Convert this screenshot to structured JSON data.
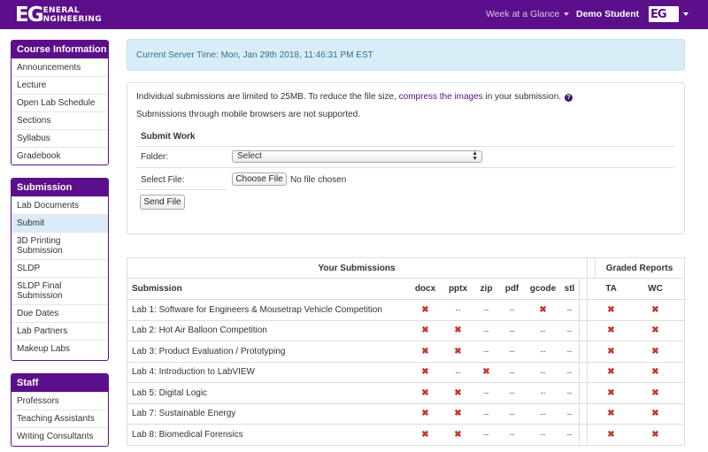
{
  "nav": {
    "logo_mark": "EG",
    "logo_line1": "ENERAL",
    "logo_line2": "NGINEERING",
    "week_label": "Week at a Glance",
    "user_label": "Demo Student",
    "user_logo_mark": "EG"
  },
  "sidebar": {
    "course": {
      "title": "Course Information",
      "items": [
        "Announcements",
        "Lecture",
        "Open Lab Schedule",
        "Sections",
        "Syllabus",
        "Gradebook"
      ]
    },
    "submission": {
      "title": "Submission",
      "items": [
        "Lab Documents",
        "Submit",
        "3D Printing Submission",
        "SLDP",
        "SLDP Final Submission",
        "Due Dates",
        "Lab Partners",
        "Makeup Labs"
      ],
      "active": "Submit"
    },
    "staff": {
      "title": "Staff",
      "items": [
        "Professors",
        "Teaching Assistants",
        "Writing Consultants"
      ]
    }
  },
  "alert": {
    "text": "Current Server Time: Mon, Jan 29th 2018, 11:46:31 PM EST"
  },
  "submit": {
    "note_before": "Individual submissions are limited to 25MB. To reduce the file size, ",
    "note_link": "compress the images",
    "note_after": " in your submission.",
    "help_glyph": "?",
    "mobile_note": "Submissions through mobile browsers are not supported.",
    "form_title": "Submit Work",
    "folder_label": "Folder:",
    "folder_value": "Select",
    "file_label": "Select File:",
    "choose_button": "Choose File",
    "no_file": "No file chosen",
    "send_button": "Send File"
  },
  "table": {
    "group_your": "Your Submissions",
    "group_graded": "Graded Reports",
    "headers": [
      "Submission",
      "docx",
      "pptx",
      "zip",
      "pdf",
      "gcode",
      "stl",
      "TA",
      "WC"
    ],
    "x_glyph": "✖",
    "dash": "--",
    "rows": [
      {
        "name": "Lab 1: Software for Engineers & Mousetrap Vehicle Competition",
        "cells": [
          "x",
          "--",
          "--",
          "--",
          "x",
          "--",
          "x",
          "x"
        ]
      },
      {
        "name": "Lab 2: Hot Air Balloon Competition",
        "cells": [
          "x",
          "x",
          "--",
          "--",
          "--",
          "--",
          "x",
          "x"
        ]
      },
      {
        "name": "Lab 3: Product Evaluation / Prototyping",
        "cells": [
          "x",
          "x",
          "--",
          "--",
          "--",
          "--",
          "x",
          "x"
        ]
      },
      {
        "name": "Lab 4: Introduction to LabVIEW",
        "cells": [
          "x",
          "--",
          "x",
          "--",
          "--",
          "--",
          "x",
          "x"
        ]
      },
      {
        "name": "Lab 5: Digital Logic",
        "cells": [
          "x",
          "x",
          "--",
          "--",
          "--",
          "--",
          "x",
          "x"
        ]
      },
      {
        "name": "Lab 7: Sustainable Energy",
        "cells": [
          "x",
          "x",
          "--",
          "--",
          "--",
          "--",
          "x",
          "x"
        ]
      },
      {
        "name": "Lab 8: Biomedical Forensics",
        "cells": [
          "x",
          "x",
          "--",
          "--",
          "--",
          "--",
          "x",
          "x"
        ]
      }
    ]
  }
}
